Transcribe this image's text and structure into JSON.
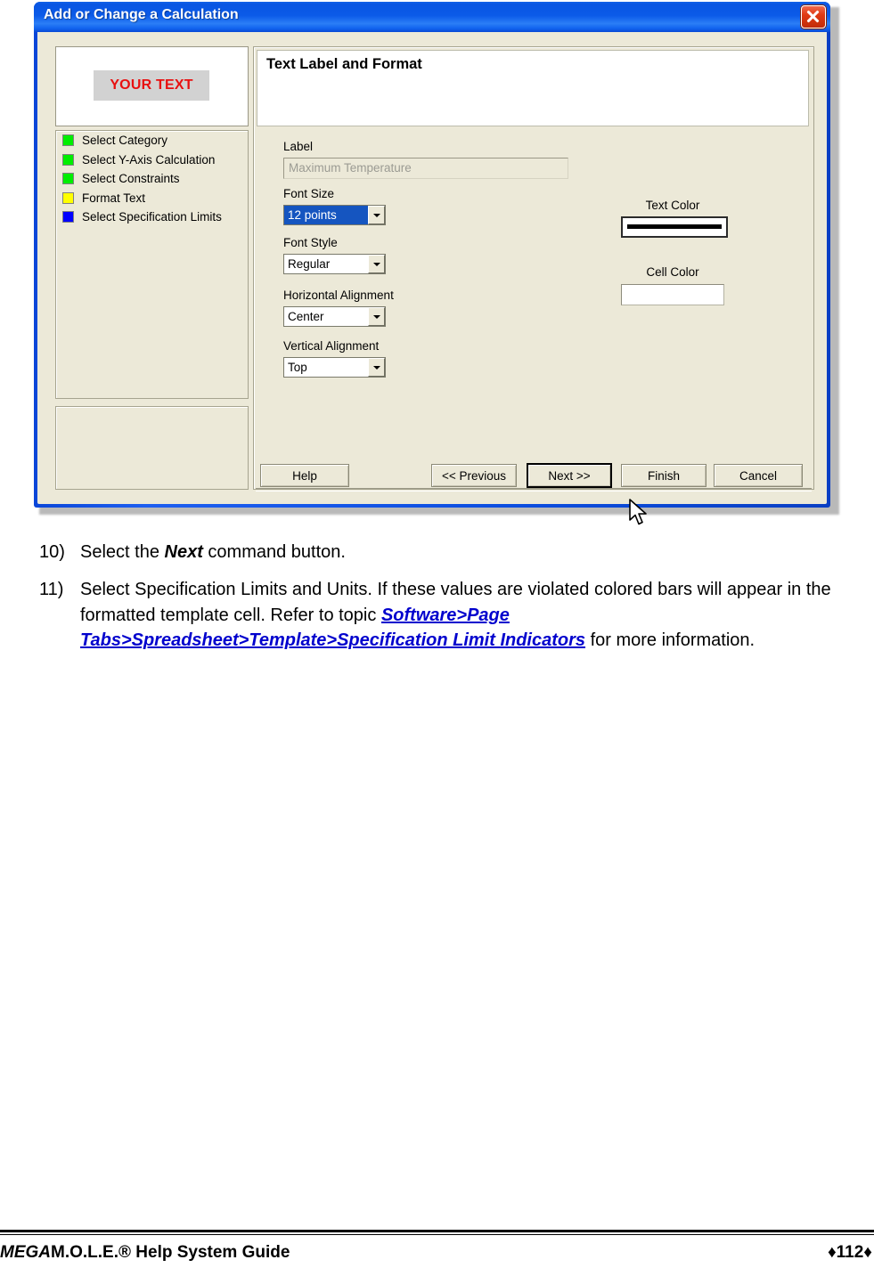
{
  "dialog": {
    "title": "Add or Change a Calculation",
    "close_icon": "close-icon",
    "preview": {
      "sample_text": "YOUR TEXT",
      "text_color": "#e81010",
      "cell_color": "#d2d2d2"
    },
    "steps": [
      {
        "label": "Select Category",
        "color": "#00ee00"
      },
      {
        "label": "Select Y-Axis Calculation",
        "color": "#00ee00"
      },
      {
        "label": "Select Constraints",
        "color": "#00ee00"
      },
      {
        "label": "Format Text",
        "color": "#ffff00"
      },
      {
        "label": "Select Specification Limits",
        "color": "#0000ff"
      }
    ],
    "panel": {
      "header_title": "Text Label and Format",
      "fields": {
        "label": {
          "caption": "Label",
          "value": "Maximum Temperature"
        },
        "font_size": {
          "caption": "Font Size",
          "value": "12 points"
        },
        "font_style": {
          "caption": "Font Style",
          "value": "Regular"
        },
        "horizontal_alignment": {
          "caption": "Horizontal Alignment",
          "value": "Center"
        },
        "vertical_alignment": {
          "caption": "Vertical Alignment",
          "value": "Top"
        }
      },
      "colors": {
        "text_color": {
          "caption": "Text Color",
          "value": "#000000"
        },
        "cell_color": {
          "caption": "Cell Color",
          "value": "#ffffff"
        }
      }
    },
    "buttons": {
      "help": "Help",
      "previous": "<< Previous",
      "next": "Next >>",
      "finish": "Finish",
      "cancel": "Cancel"
    }
  },
  "instructions": [
    {
      "number": "10)",
      "parts": [
        {
          "type": "text",
          "text": "Select the "
        },
        {
          "type": "bold",
          "text": "Next"
        },
        {
          "type": "text",
          "text": " command button."
        }
      ]
    },
    {
      "number": "11)",
      "parts": [
        {
          "type": "text",
          "text": "Select Specification Limits and Units. If these values are violated colored bars will appear in the formatted template cell. Refer to  topic "
        },
        {
          "type": "link",
          "text": "Software>Page Tabs>Spreadsheet>Template>Specification Limit Indicators"
        },
        {
          "type": "text",
          "text": " for more information."
        }
      ]
    }
  ],
  "footer": {
    "brand_italic": "MEGA",
    "brand_rest": "M.O.L.E.® Help System Guide",
    "page": "♦112♦"
  }
}
